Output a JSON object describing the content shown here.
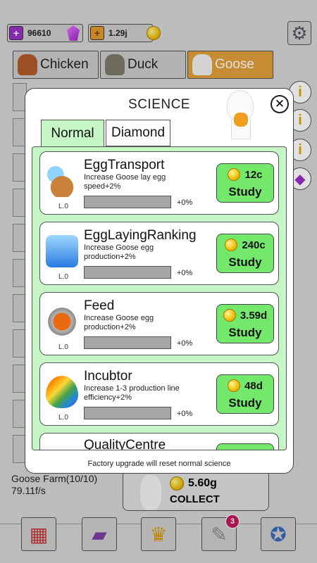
{
  "resources": {
    "gems": "96610",
    "coins": "1.29j"
  },
  "animal_tabs": [
    {
      "label": "Chicken"
    },
    {
      "label": "Duck"
    },
    {
      "label": "Goose",
      "active": true
    }
  ],
  "farm": {
    "name": "Goose Farm(10/10)",
    "rate": "79.11f/s"
  },
  "collect": {
    "amount": "5.60g",
    "label": "COLLECT"
  },
  "bottom_nav": {
    "badge_count": "3",
    "items": [
      "shop-icon",
      "book-icon",
      "trophy-icon",
      "scroll-icon",
      "compass-icon"
    ]
  },
  "science": {
    "title": "SCIENCE",
    "tabs": [
      {
        "label": "Normal",
        "active": true
      },
      {
        "label": "Diamond"
      }
    ],
    "upgrades": [
      {
        "name": "EggTransport",
        "desc": "Increase Goose lay egg speed+2%",
        "level": "L.0",
        "progress": "+0%",
        "cost": "12c",
        "action": "Study",
        "icon": "boots-icon"
      },
      {
        "name": "EggLayingRanking",
        "desc": "Increase Goose egg production+2%",
        "level": "L.0",
        "progress": "+0%",
        "cost": "240c",
        "action": "Study",
        "icon": "bottles-icon"
      },
      {
        "name": "Feed",
        "desc": "Increase Goose egg production+2%",
        "level": "L.0",
        "progress": "+0%",
        "cost": "3.59d",
        "action": "Study",
        "icon": "feed-can-icon"
      },
      {
        "name": "Incubtor",
        "desc": "Increase 1-3 production line efficiency+2%",
        "level": "L.0",
        "progress": "+0%",
        "cost": "48d",
        "action": "Study",
        "icon": "rainbow-egg-icon"
      },
      {
        "name": "QualityCentre"
      }
    ],
    "footer": "Factory upgrade will reset normal science"
  },
  "colors": {
    "accent_green": "#74e86a",
    "list_bg": "#c6f5c6",
    "active_tab": "#e2a03c"
  }
}
